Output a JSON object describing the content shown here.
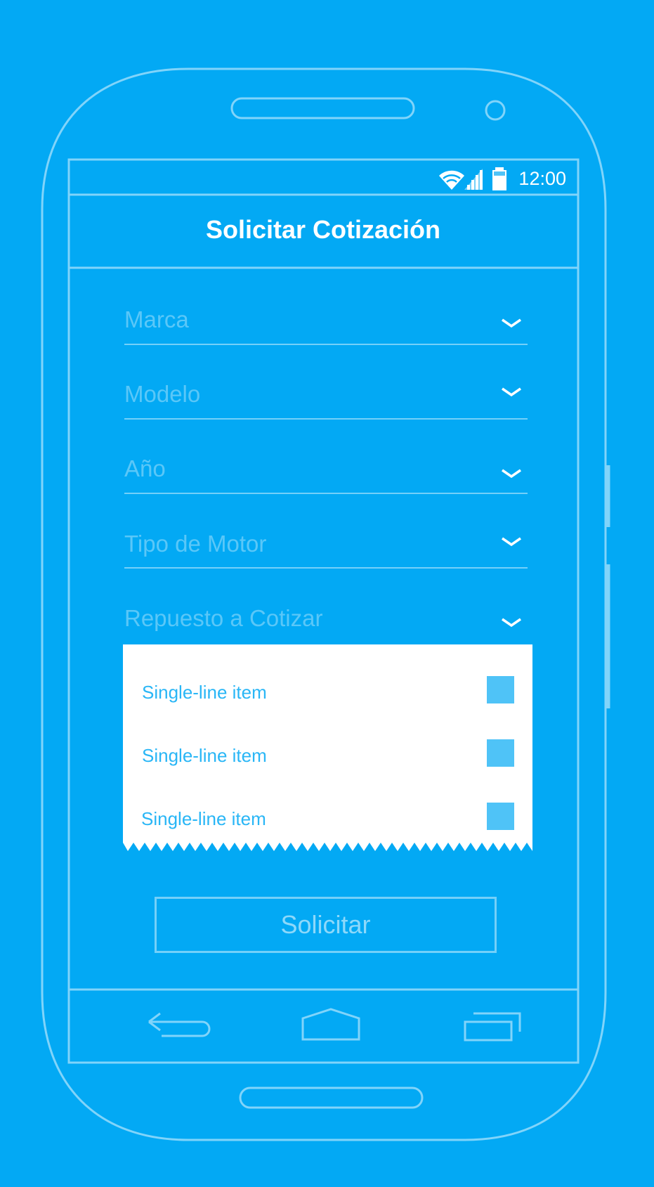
{
  "status_bar": {
    "time": "12:00",
    "icons": [
      "wifi-icon",
      "signal-icon",
      "battery-icon"
    ]
  },
  "app_bar": {
    "title": "Solicitar Cotización"
  },
  "form": {
    "fields": [
      {
        "label": "Marca",
        "icon": "chevron-down-icon"
      },
      {
        "label": "Modelo",
        "icon": "chevron-down-icon"
      },
      {
        "label": "Año",
        "icon": "chevron-down-icon"
      },
      {
        "label": "Tipo de Motor",
        "icon": "chevron-down-icon"
      },
      {
        "label": "Repuesto a Cotizar",
        "icon": "chevron-down-icon"
      }
    ]
  },
  "dropdown": {
    "items": [
      {
        "label": "Single-line item",
        "checked": false
      },
      {
        "label": "Single-line item",
        "checked": false
      },
      {
        "label": "Single-line item",
        "checked": false
      }
    ]
  },
  "submit_button": {
    "label": "Solicitar"
  },
  "nav_bar": {
    "buttons": [
      "back-icon",
      "home-icon",
      "recent-apps-icon"
    ]
  },
  "colors": {
    "background": "#03A9F4",
    "outline": "#81D4FA",
    "accent_text": "#29B6F6",
    "checkbox": "#4FC3F7",
    "dropdown_bg": "#FFFFFF"
  }
}
